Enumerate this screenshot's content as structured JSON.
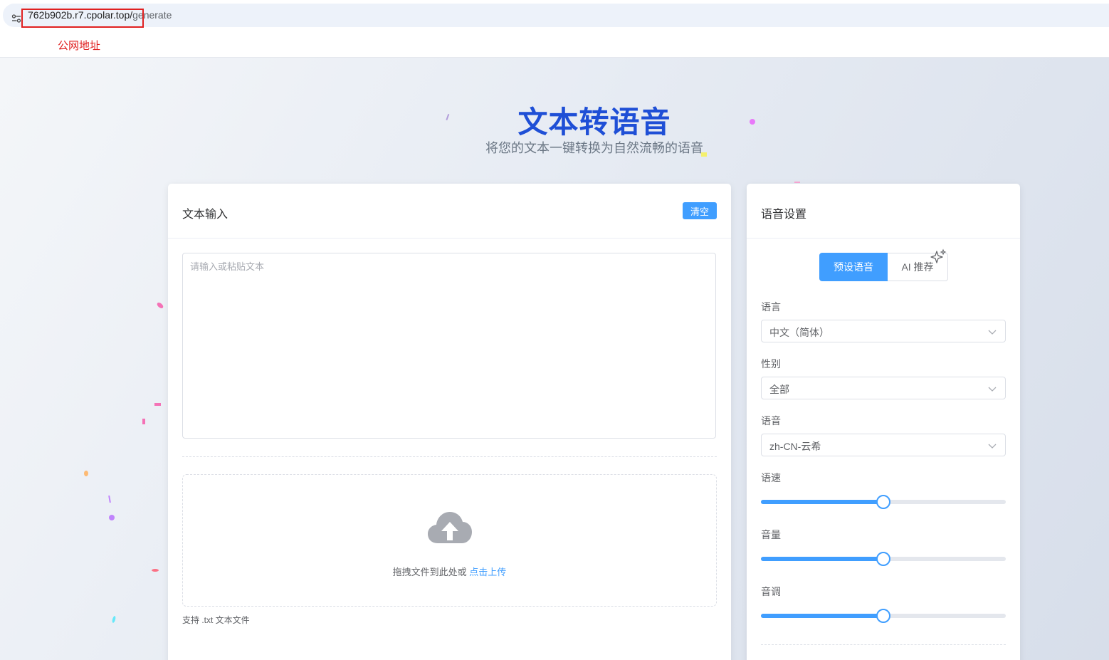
{
  "browser": {
    "url_host": "762b902b.r7.cpolar.top/",
    "url_path": "generate",
    "annotation": "公网地址"
  },
  "hero": {
    "title": "文本转语音",
    "subtitle": "将您的文本一键转换为自然流畅的语音"
  },
  "text_card": {
    "title": "文本输入",
    "clear_label": "清空",
    "textarea_placeholder": "请输入或粘贴文本",
    "textarea_value": "",
    "upload_text": "拖拽文件到此处或 ",
    "upload_link": "点击上传",
    "upload_tip": "支持 .txt 文本文件"
  },
  "voice_card": {
    "title": "语音设置",
    "tabs": [
      {
        "label": "预设语音",
        "active": true
      },
      {
        "label": "AI 推荐",
        "active": false
      }
    ],
    "language": {
      "label": "语言",
      "value": "中文（简体）"
    },
    "gender": {
      "label": "性别",
      "value": "全部"
    },
    "voice": {
      "label": "语音",
      "value": "zh-CN-云希"
    },
    "rate": {
      "label": "语速",
      "fraction": 0.5
    },
    "volume": {
      "label": "音量",
      "fraction": 0.5
    },
    "pitch": {
      "label": "音调",
      "fraction": 0.5
    }
  },
  "colors": {
    "accent": "#409eff",
    "title_blue": "#1f4fd6",
    "highlight_red": "#e02020"
  },
  "icons": [
    "site-settings-icon",
    "upload-cloud-icon",
    "sparkle-icon",
    "chevron-down-icon"
  ]
}
